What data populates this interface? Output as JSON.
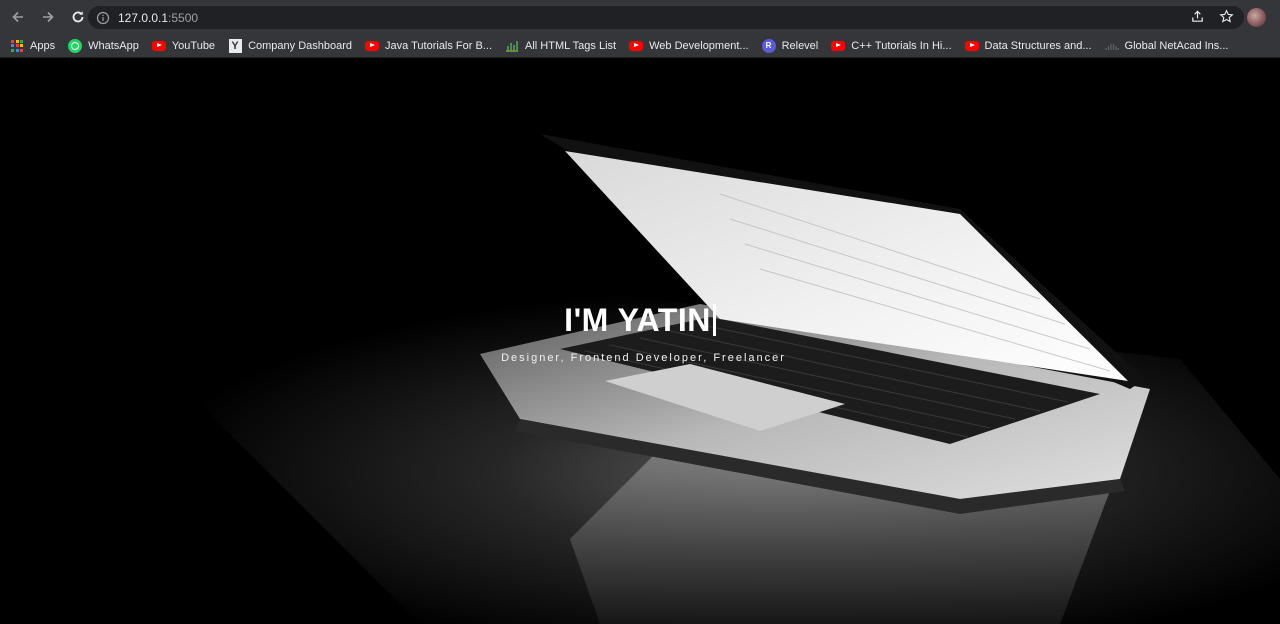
{
  "browser": {
    "url_host": "127.0.0.1",
    "url_port": ":5500"
  },
  "bookmarks": [
    {
      "label": "Apps",
      "icon": "apps-grid-icon"
    },
    {
      "label": "WhatsApp",
      "icon": "whatsapp-icon"
    },
    {
      "label": "YouTube",
      "icon": "youtube-icon"
    },
    {
      "label": "Company Dashboard",
      "icon": "ycombinator-icon"
    },
    {
      "label": "Java Tutorials For B...",
      "icon": "youtube-icon"
    },
    {
      "label": "All HTML Tags List",
      "icon": "chart-icon"
    },
    {
      "label": "Web Development...",
      "icon": "youtube-icon"
    },
    {
      "label": "Relevel",
      "icon": "relevel-icon"
    },
    {
      "label": "C++ Tutorials In Hi...",
      "icon": "youtube-icon"
    },
    {
      "label": "Data Structures and...",
      "icon": "youtube-icon"
    },
    {
      "label": "Global NetAcad Ins...",
      "icon": "cisco-icon"
    }
  ],
  "hero": {
    "title": "I'M YATIN",
    "subtitle": "Designer, Frontend Developer, Freelancer"
  },
  "colors": {
    "chrome": "#35363a",
    "omnibox": "#202124",
    "youtube": "#ff0000",
    "whatsapp": "#25d366",
    "relevel": "#5b5bd6"
  }
}
